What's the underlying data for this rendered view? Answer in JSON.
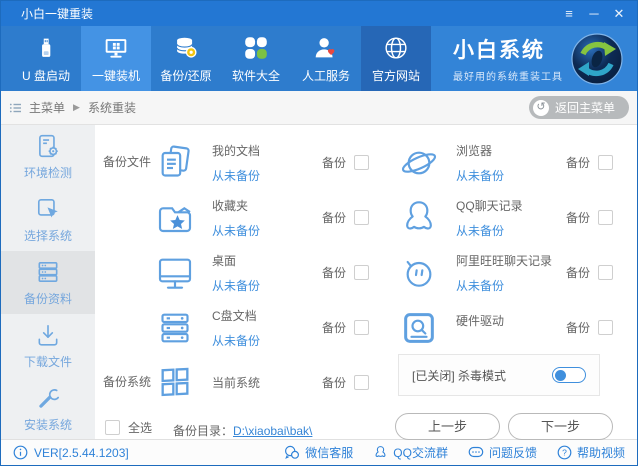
{
  "window": {
    "title": "小白一键重装",
    "controls": {
      "menu": "≡",
      "minimize": "─",
      "close": "✕"
    }
  },
  "nav": {
    "items": [
      {
        "label": "U 盘启动"
      },
      {
        "label": "一键装机",
        "state": "active"
      },
      {
        "label": "备份/还原"
      },
      {
        "label": "软件大全"
      },
      {
        "label": "人工服务"
      },
      {
        "label": "官方网站",
        "state": "pressed"
      }
    ],
    "brand": {
      "name": "小白系统",
      "slogan": "最好用的系统重装工具"
    }
  },
  "breadcrumb": {
    "root": "主菜单",
    "separator": "▶",
    "current": "系统重装",
    "back_label": "返回主菜单",
    "back_icon": "↺"
  },
  "sidebar": {
    "items": [
      {
        "label": "环境检测"
      },
      {
        "label": "选择系统"
      },
      {
        "label": "备份资料",
        "state": "active"
      },
      {
        "label": "下载文件"
      },
      {
        "label": "安装系统"
      }
    ]
  },
  "main": {
    "groups": {
      "files_label": "备份文件",
      "system_label": "备份系统"
    },
    "backup_label": "备份",
    "items": [
      {
        "name": "我的文档",
        "status": "从未备份"
      },
      {
        "name": "收藏夹",
        "status": "从未备份"
      },
      {
        "name": "桌面",
        "status": "从未备份"
      },
      {
        "name": "C盘文档",
        "status": "从未备份"
      },
      {
        "name": "浏览器",
        "status": "从未备份"
      },
      {
        "name": "QQ聊天记录",
        "status": "从未备份"
      },
      {
        "name": "阿里旺旺聊天记录",
        "status": "从未备份"
      },
      {
        "name": "硬件驱动",
        "status": ""
      }
    ],
    "system_row": {
      "name": "当前系统"
    },
    "antivirus": {
      "label": "[已关闭] 杀毒模式",
      "state": "off"
    },
    "select_all_label": "全选",
    "backup_dir": {
      "label": "备份目录：",
      "path": "D:\\xiaobai\\bak\\"
    },
    "buttons": {
      "prev": "上一步",
      "next": "下一步"
    }
  },
  "statusbar": {
    "version": "VER[2.5.44.1203]",
    "links": [
      {
        "label": "微信客服"
      },
      {
        "label": "QQ交流群"
      },
      {
        "label": "问题反馈"
      },
      {
        "label": "帮助视频"
      }
    ]
  },
  "colors": {
    "window_border": "#1d6bbd",
    "titlebar_bg": "#2377d3",
    "nav_bg": "#2e7ccd",
    "nav_active_bg": "#4493e4",
    "nav_official_bg": "#2667b6",
    "brand_bg": "#3384d7",
    "accent_blue": "#3f8fdd",
    "icon_blue": "#5fa0e0",
    "sidebar_icon_blue": "#6fa8e0",
    "link_blue": "#3585d6",
    "green": "#7cc143",
    "red": "#e8483f",
    "coin_yellow": "#f2c511",
    "footer_blue": "#2f82d8",
    "text_gray": "#666666"
  }
}
